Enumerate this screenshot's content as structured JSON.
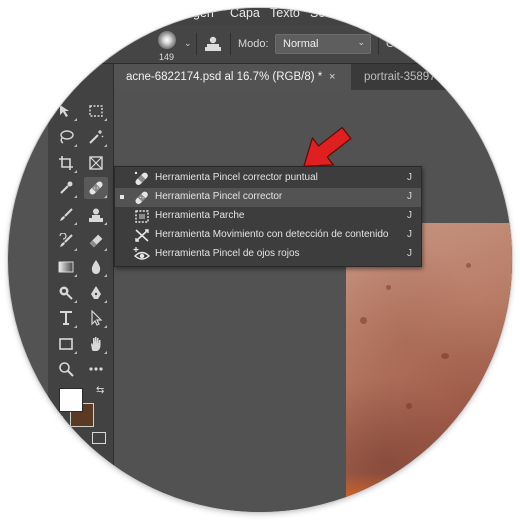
{
  "menubar": {
    "items": [
      "agen",
      "Capa",
      "Texto",
      "Sel"
    ]
  },
  "options_bar": {
    "brush_size": "149",
    "mode_label": "Modo:",
    "mode_value": "Normal",
    "right_fragment": "O"
  },
  "tabs": [
    {
      "label": "acne-6822174.psd al 16.7% (RGB/8) *",
      "close": "×"
    },
    {
      "label": "portrait-35897"
    }
  ],
  "flyout": {
    "items": [
      {
        "label": "Herramienta Pincel corrector puntual",
        "shortcut": "J",
        "icon": "spot-healing-brush-icon",
        "selected": false
      },
      {
        "label": "Herramienta Pincel corrector",
        "shortcut": "J",
        "icon": "healing-brush-icon",
        "selected": true
      },
      {
        "label": "Herramienta Parche",
        "shortcut": "J",
        "icon": "patch-icon",
        "selected": false
      },
      {
        "label": "Herramienta Movimiento con detección de contenido",
        "shortcut": "J",
        "icon": "content-aware-move-icon",
        "selected": false
      },
      {
        "label": "Herramienta Pincel de ojos rojos",
        "shortcut": "J",
        "icon": "red-eye-icon",
        "selected": false
      }
    ]
  },
  "colors": {
    "foreground": "#ffffff",
    "background": "#5a3a22",
    "arrow": "#e02020"
  }
}
